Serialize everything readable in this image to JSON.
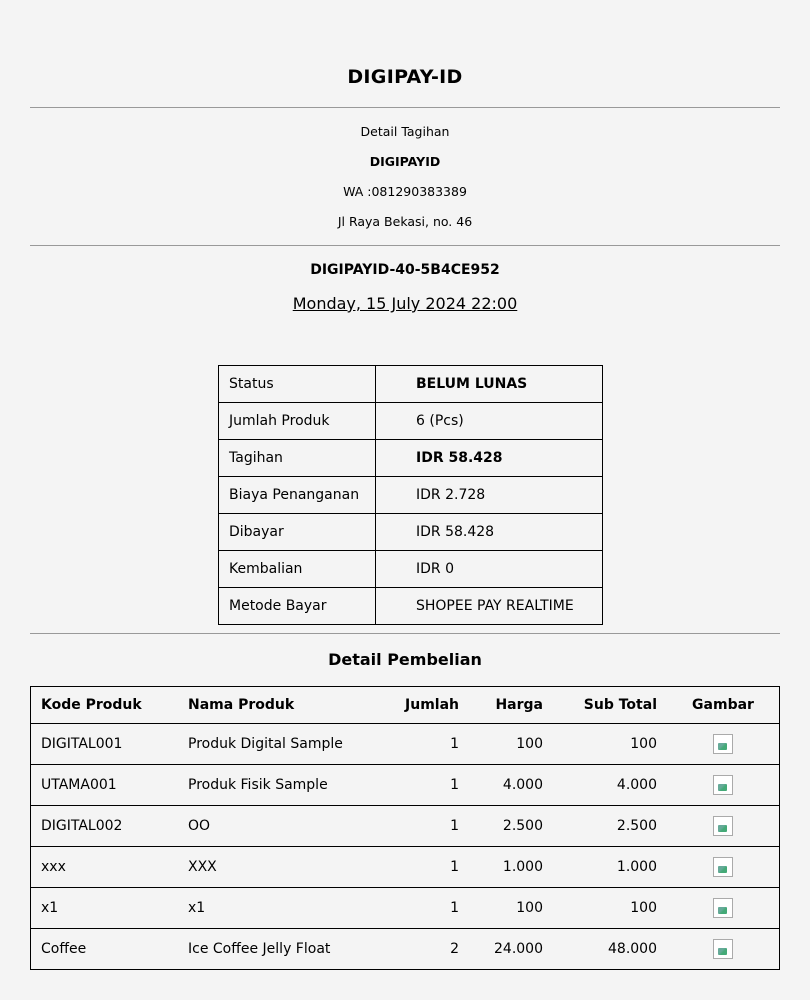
{
  "header": {
    "title": "DIGIPAY-ID",
    "subtitle": "Detail Tagihan",
    "store_name": "DIGIPAYID",
    "whatsapp": "WA :081290383389",
    "address": "Jl Raya Bekasi, no. 46"
  },
  "invoice": {
    "id": "DIGIPAYID-40-5B4CE952",
    "datetime": "Monday, 15 July 2024 22:00"
  },
  "summary": [
    {
      "label": "Status",
      "value": "BELUM LUNAS",
      "bold": true
    },
    {
      "label": "Jumlah Produk",
      "value": "6 (Pcs)",
      "bold": false
    },
    {
      "label": "Tagihan",
      "value": "IDR 58.428",
      "bold": true
    },
    {
      "label": "Biaya Penanganan",
      "value": "IDR 2.728",
      "bold": false
    },
    {
      "label": "Dibayar",
      "value": "IDR 58.428",
      "bold": false
    },
    {
      "label": "Kembalian",
      "value": "IDR 0",
      "bold": false
    },
    {
      "label": "Metode Bayar",
      "value": "SHOPEE PAY REALTIME",
      "bold": false
    }
  ],
  "items_section": {
    "title": "Detail Pembelian",
    "columns": [
      "Kode Produk",
      "Nama Produk",
      "Jumlah",
      "Harga",
      "Sub Total",
      "Gambar"
    ],
    "rows": [
      {
        "code": "DIGITAL001",
        "name": "Produk Digital Sample",
        "qty": "1",
        "price": "100",
        "subtotal": "100",
        "image_icon": "broken-image-icon"
      },
      {
        "code": "UTAMA001",
        "name": "Produk Fisik Sample",
        "qty": "1",
        "price": "4.000",
        "subtotal": "4.000",
        "image_icon": "broken-image-icon"
      },
      {
        "code": "DIGITAL002",
        "name": "OO",
        "qty": "1",
        "price": "2.500",
        "subtotal": "2.500",
        "image_icon": "broken-image-icon"
      },
      {
        "code": "xxx",
        "name": "XXX",
        "qty": "1",
        "price": "1.000",
        "subtotal": "1.000",
        "image_icon": "broken-image-icon"
      },
      {
        "code": "x1",
        "name": "x1",
        "qty": "1",
        "price": "100",
        "subtotal": "100",
        "image_icon": "broken-image-icon"
      },
      {
        "code": "Coffee",
        "name": "Ice Coffee Jelly Float",
        "qty": "2",
        "price": "24.000",
        "subtotal": "48.000",
        "image_icon": "broken-image-icon"
      }
    ]
  }
}
